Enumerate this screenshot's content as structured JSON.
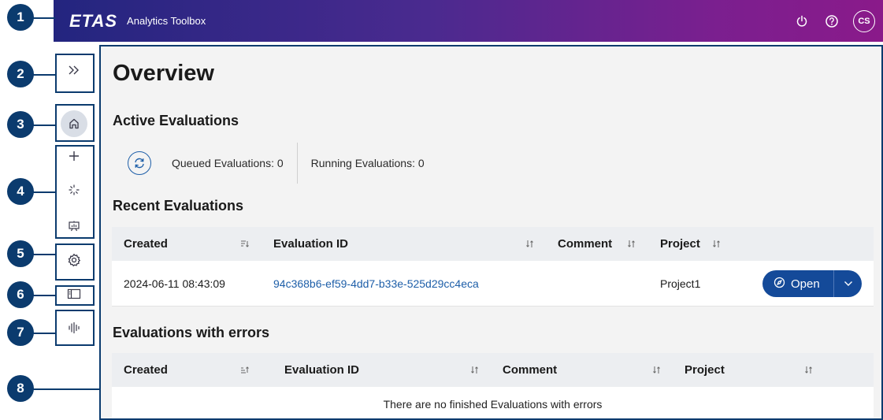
{
  "header": {
    "logo": "ETAS",
    "app_name": "Analytics Toolbox",
    "avatar_initials": "CS",
    "icons": [
      "power-icon",
      "help-icon"
    ],
    "gradient": [
      "#23257f",
      "#8a1a8a"
    ]
  },
  "callouts": [
    "1",
    "2",
    "3",
    "4",
    "5",
    "6",
    "7",
    "8"
  ],
  "sidebar": {
    "items": [
      "expand-icon",
      "home-icon",
      "add-icon",
      "loading-icon",
      "dashboard-icon",
      "settings-icon",
      "panel-icon",
      "waveform-icon"
    ]
  },
  "main": {
    "title": "Overview",
    "active": {
      "title": "Active Evaluations",
      "queued": "Queued Evaluations: 0",
      "running": "Running Evaluations: 0"
    },
    "recent": {
      "title": "Recent Evaluations",
      "columns": [
        "Created",
        "Evaluation ID",
        "Comment",
        "Project"
      ],
      "rows": [
        {
          "created": "2024-06-11 08:43:09",
          "evaluation_id": "94c368b6-ef59-4dd7-b33e-525d29cc4eca",
          "comment": "",
          "project": "Project1",
          "action": "Open"
        }
      ]
    },
    "errors": {
      "title": "Evaluations with errors",
      "columns": [
        "Created",
        "Evaluation ID",
        "Comment",
        "Project"
      ],
      "empty_message": "There are no finished Evaluations with errors"
    }
  },
  "colors": {
    "accent": "#144a99",
    "link": "#1d5ea8",
    "callout": "#0b3b6e"
  }
}
